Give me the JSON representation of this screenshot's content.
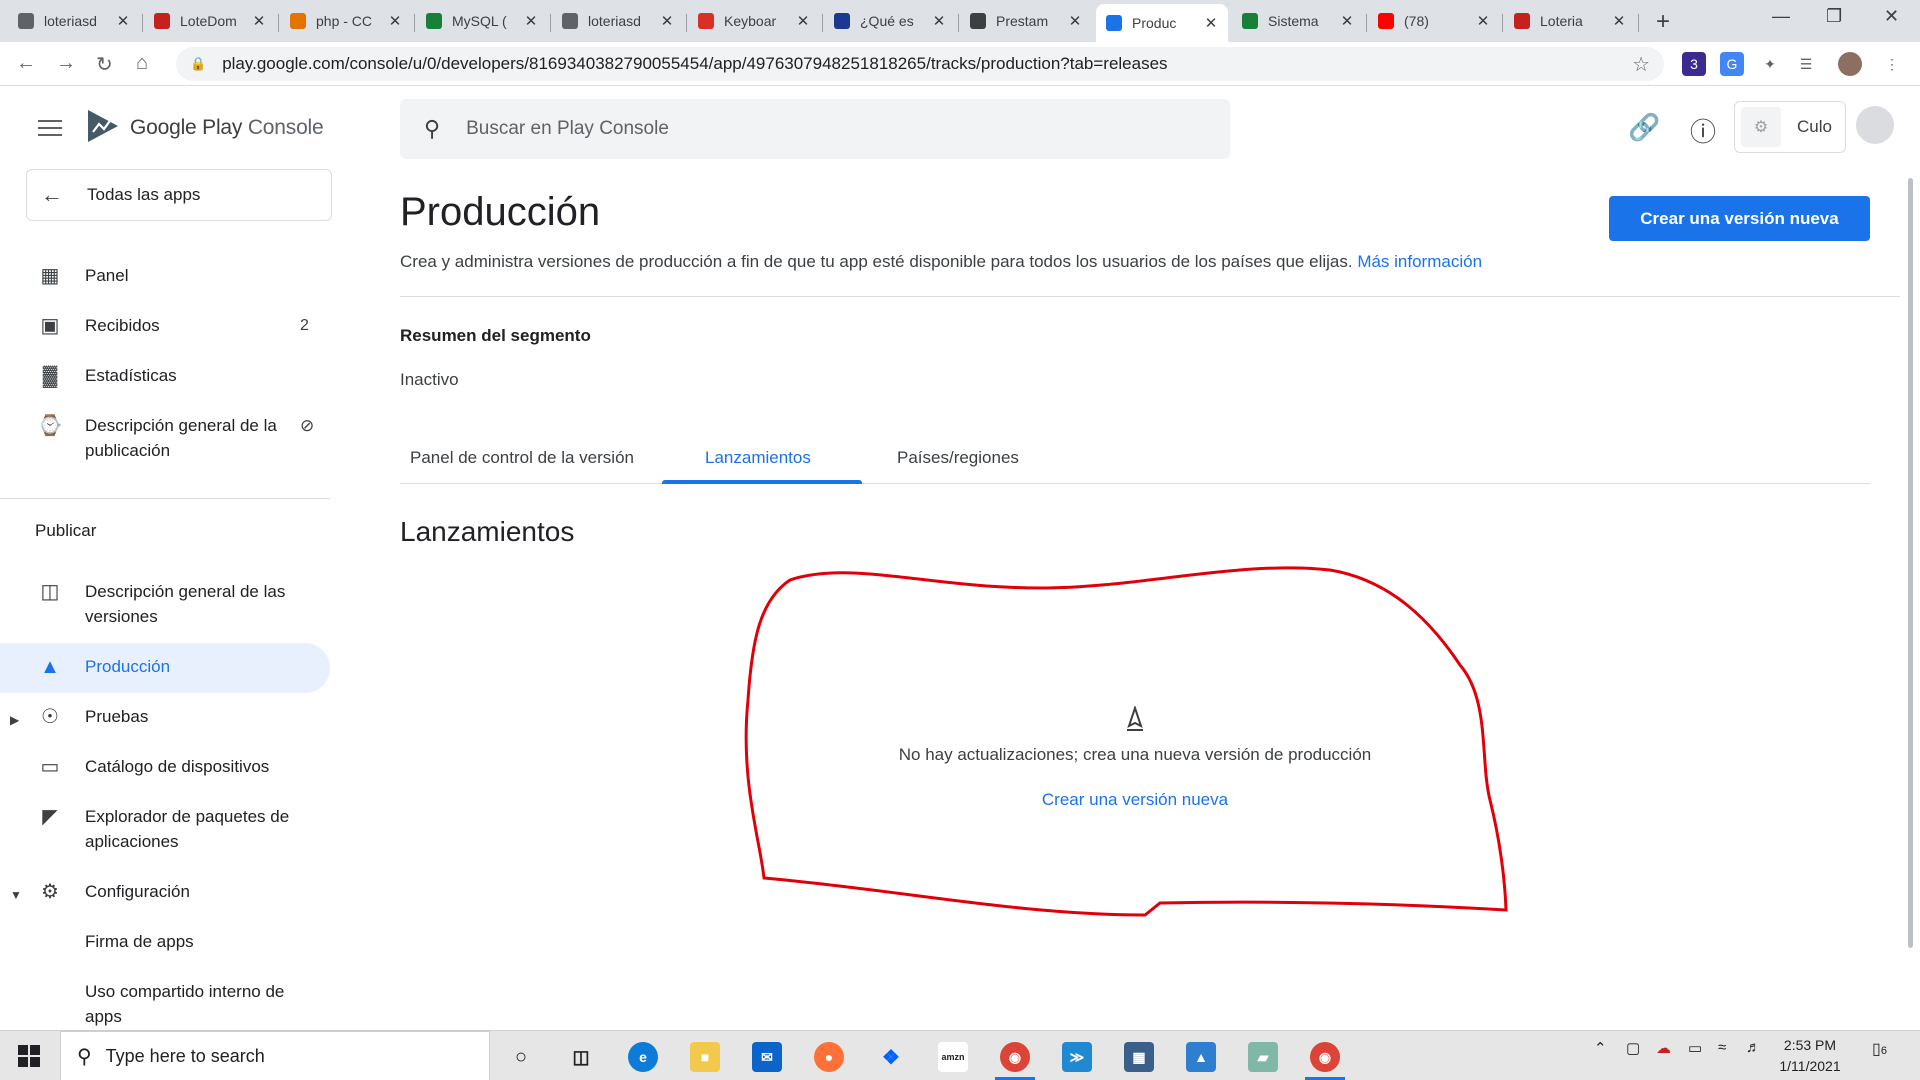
{
  "browser": {
    "tabs": [
      {
        "title": "loteriasd",
        "color": "#5f6368",
        "icon": "globe-icon"
      },
      {
        "title": "LoteDom",
        "color": "#c5221f",
        "icon": "loto-icon"
      },
      {
        "title": "php - CC",
        "color": "#e37400",
        "icon": "stackoverflow-icon"
      },
      {
        "title": "MySQL (",
        "color": "#188038",
        "icon": "w3schools-icon"
      },
      {
        "title": "loteriasd",
        "color": "#5f6368",
        "icon": "globe-icon"
      },
      {
        "title": "Keyboar",
        "color": "#d93025",
        "icon": "typingclub-icon"
      },
      {
        "title": "¿Qué es",
        "color": "#1a3a8f",
        "icon": "paypal-icon"
      },
      {
        "title": "Prestam",
        "color": "#3c4043",
        "icon": "document-icon"
      },
      {
        "title": "Produc",
        "color": "#1a73e8",
        "icon": "play-console-icon"
      },
      {
        "title": "Sistema",
        "color": "#188038",
        "icon": "evernote-icon"
      },
      {
        "title": "(78)",
        "color": "#ff0000",
        "icon": "youtube-icon"
      },
      {
        "title": "Loteria",
        "color": "#c5221f",
        "icon": "loto-icon"
      }
    ],
    "active_tab": 8,
    "url": "play.google.com/console/u/0/developers/8169340382790055454/app/4976307948251818265/tracks/production?tab=releases"
  },
  "header": {
    "brand_main": "Google Play",
    "brand_sub": "Console",
    "search_placeholder": "Buscar en Play Console",
    "developer_name": "Culo"
  },
  "sidebar": {
    "all_apps": "Todas las apps",
    "items": [
      {
        "label": "Panel",
        "badge": ""
      },
      {
        "label": "Recibidos",
        "badge": "2"
      },
      {
        "label": "Estadísticas",
        "badge": ""
      },
      {
        "label": "Descripción general de la publicación",
        "badge": ""
      }
    ],
    "section_publish": "Publicar",
    "publish_items": [
      {
        "label": "Descripción general de las versiones"
      },
      {
        "label": "Producción"
      },
      {
        "label": "Pruebas"
      },
      {
        "label": "Catálogo de dispositivos"
      },
      {
        "label": "Explorador de paquetes de aplicaciones"
      },
      {
        "label": "Configuración"
      },
      {
        "label": "Firma de apps"
      },
      {
        "label": "Uso compartido interno de apps"
      }
    ]
  },
  "main": {
    "title": "Producción",
    "description": "Crea y administra versiones de producción a fin de que tu app esté disponible para todos los usuarios de los países que elijas.",
    "more_info": "Más información",
    "create_button": "Crear una versión nueva",
    "segment_title": "Resumen del segmento",
    "segment_status": "Inactivo",
    "tabs": [
      {
        "label": "Panel de control de la versión"
      },
      {
        "label": "Lanzamientos"
      },
      {
        "label": "Países/regiones"
      }
    ],
    "active_tab": 1,
    "section_title": "Lanzamientos",
    "empty_text": "No hay actualizaciones; crea una nueva versión de producción",
    "empty_link": "Crear una versión nueva"
  },
  "taskbar": {
    "search_placeholder": "Type here to search",
    "time": "2:53 PM",
    "date": "1/11/2021",
    "notification_count": "6"
  },
  "colors": {
    "accent": "#1a73e8",
    "active_nav_bg": "#e8f0fe",
    "annotation": "#e0000a"
  }
}
